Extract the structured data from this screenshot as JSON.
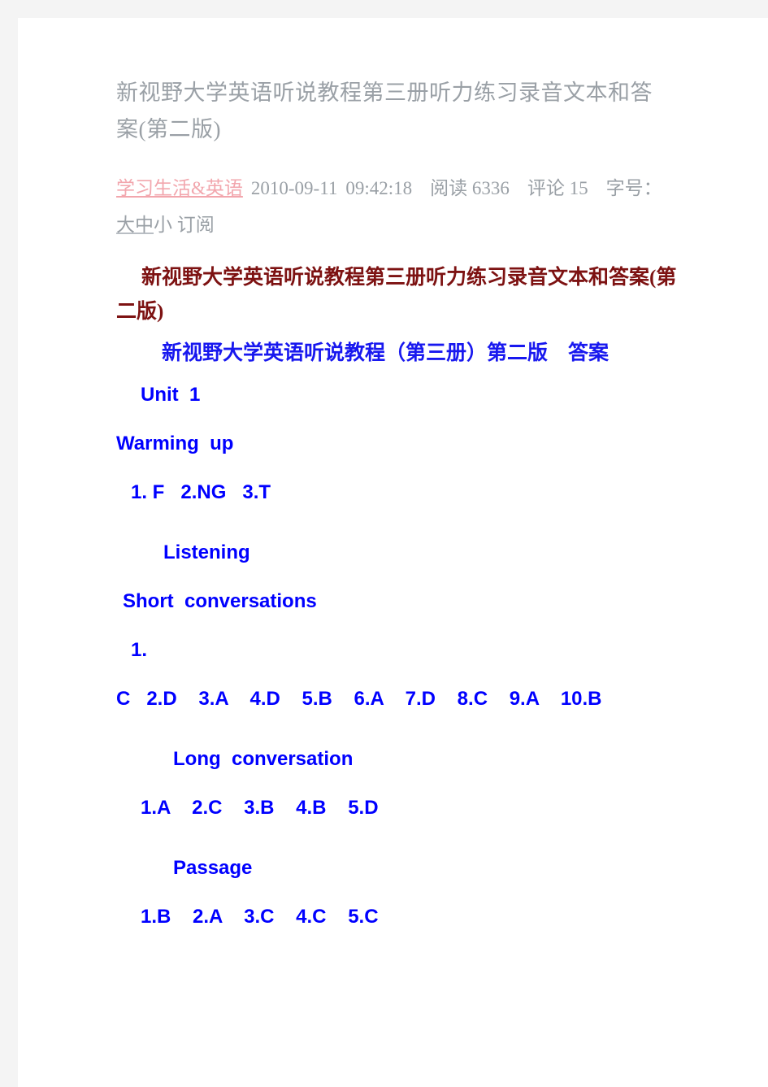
{
  "page": {
    "background_color": "#f4f4f4",
    "sheet_color": "#ffffff"
  },
  "colors": {
    "title_gray": "#9aa0a6",
    "category_link_pink": "#f2a6ad",
    "heading_maroon": "#7d1212",
    "heading_blue_serif": "#1818ef",
    "answer_blue": "#0000ff"
  },
  "document": {
    "title": "新视野大学英语听说教程第三册听力练习录音文本和答案(第二版)",
    "meta": {
      "category": "学习生活&英语",
      "date": "2010-09-11",
      "time": "09:42:18",
      "read_label": "阅读",
      "read_count": "6336",
      "comment_label": "评论",
      "comment_count": "15",
      "font_size_label": "字号：",
      "font_size_large": "大",
      "font_size_medium": "中",
      "font_size_small": "小",
      "subscribe": "订阅"
    },
    "red_heading": "新视野大学英语听说教程第三册听力练习录音文本和答案(第二版)",
    "blue_heading": "新视野大学英语听说教程（第三册）第二版　答案",
    "sections": [
      {
        "name": "unit",
        "text": "Unit  1"
      },
      {
        "name": "warming-up-heading",
        "text": "Warming  up"
      },
      {
        "name": "warming-up-answers",
        "text": "1. F   2.NG   3.T"
      },
      {
        "name": "listening-heading",
        "text": "Listening"
      },
      {
        "name": "short-conversations-heading",
        "text": "Short  conversations"
      },
      {
        "name": "short-conversations-number",
        "text": "1."
      },
      {
        "name": "short-conversations-answers",
        "text": "C   2.D    3.A    4.D    5.B    6.A    7.D    8.C    9.A    10.B"
      },
      {
        "name": "long-conversation-heading",
        "text": "Long  conversation"
      },
      {
        "name": "long-conversation-answers",
        "text": "1.A    2.C    3.B    4.B    5.D"
      },
      {
        "name": "passage-heading",
        "text": "Passage"
      },
      {
        "name": "passage-answers",
        "text": "1.B    2.A    3.C    4.C    5.C"
      }
    ]
  }
}
